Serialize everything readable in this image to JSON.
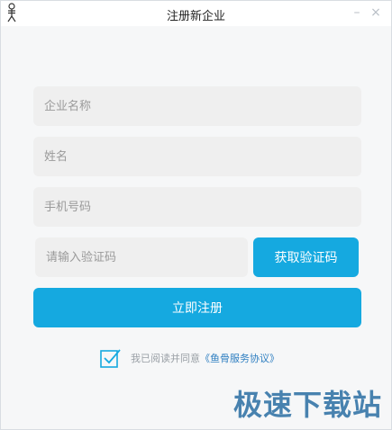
{
  "window": {
    "title": "注册新企业",
    "minimize_symbol": "–",
    "close_symbol": "×"
  },
  "form": {
    "company_placeholder": "企业名称",
    "name_placeholder": "姓名",
    "phone_placeholder": "手机号码",
    "code_placeholder": "请输入验证码",
    "get_code_label": "获取验证码",
    "register_label": "立即注册"
  },
  "agreement": {
    "text": "我已阅读并同意",
    "link": "《鱼骨服务协议》",
    "checked": true
  },
  "watermark": "极速下载站",
  "colors": {
    "accent": "#15a9e0",
    "link": "#2f7fc1",
    "field_bg": "#efefef",
    "window_bg": "#f6f7f8"
  },
  "icons": {
    "app": "fishbone-stickman-icon",
    "checkbox": "checkbox-checked-icon"
  }
}
